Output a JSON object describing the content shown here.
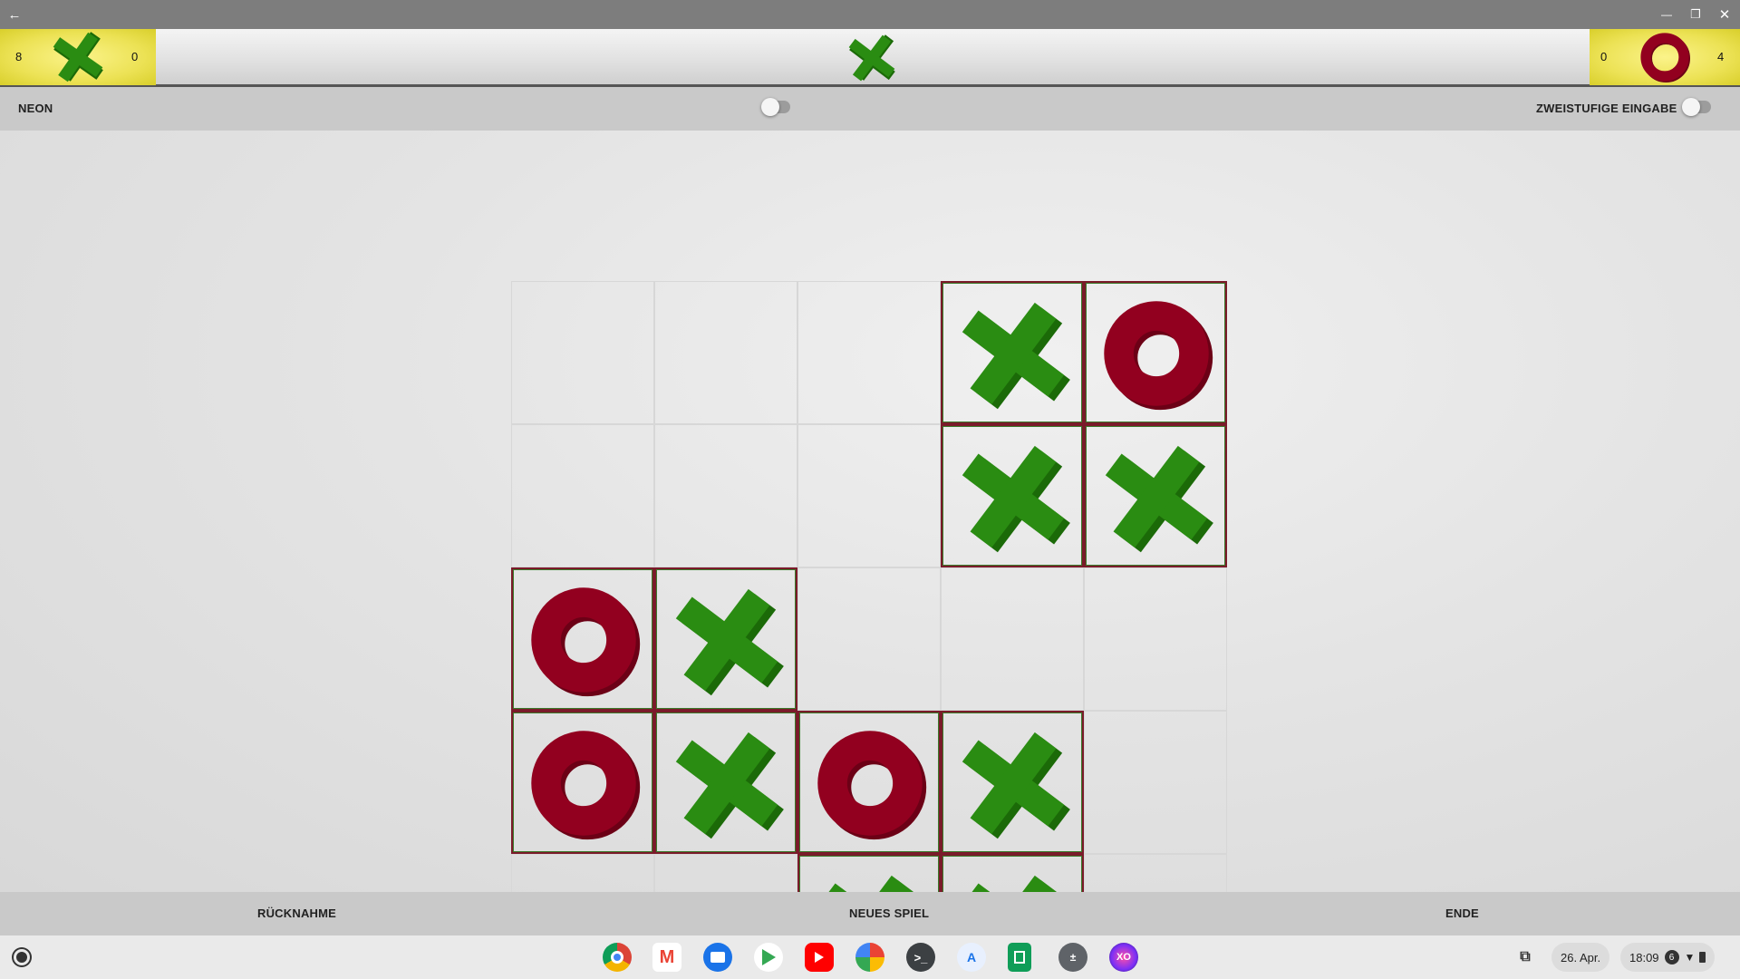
{
  "titlebar": {
    "back_icon": "←",
    "minimize_icon": "—",
    "restore_icon": "❐",
    "close_icon": "✕"
  },
  "scoreboard": {
    "x_player": {
      "left_count": "8",
      "right_count": "0"
    },
    "o_player": {
      "left_count": "0",
      "right_count": "4"
    },
    "current_turn": "X"
  },
  "options": {
    "neon_label": "NEON",
    "two_step_label": "ZWEISTUFIGE EINGABE",
    "neon_on": false,
    "two_step_on": false
  },
  "board": {
    "rows": 6,
    "cols": 5,
    "cells": [
      [
        "",
        "",
        "",
        "X",
        "O"
      ],
      [
        "",
        "",
        "",
        "X",
        "X"
      ],
      [
        "O",
        "X",
        "",
        "",
        ""
      ],
      [
        "O",
        "X",
        "O",
        "X",
        ""
      ],
      [
        "",
        "",
        "X",
        "X",
        ""
      ]
    ],
    "colors": {
      "x": "#2a8c12",
      "x_dark": "#1b6a08",
      "o": "#92001f",
      "o_dark": "#6c0016"
    }
  },
  "bottom_buttons": {
    "undo": "RÜCKNAHME",
    "new_game": "NEUES SPIEL",
    "end": "ENDE"
  },
  "shelf": {
    "apps": [
      "chrome-icon",
      "gmail-icon",
      "files-icon",
      "play-store-icon",
      "youtube-icon",
      "photos-icon",
      "terminal-icon",
      "app-icon",
      "sheets-icon",
      "calculator-icon",
      "tictactoe-icon"
    ],
    "date": "26. Apr.",
    "time": "18:09",
    "notification_count": "6"
  }
}
